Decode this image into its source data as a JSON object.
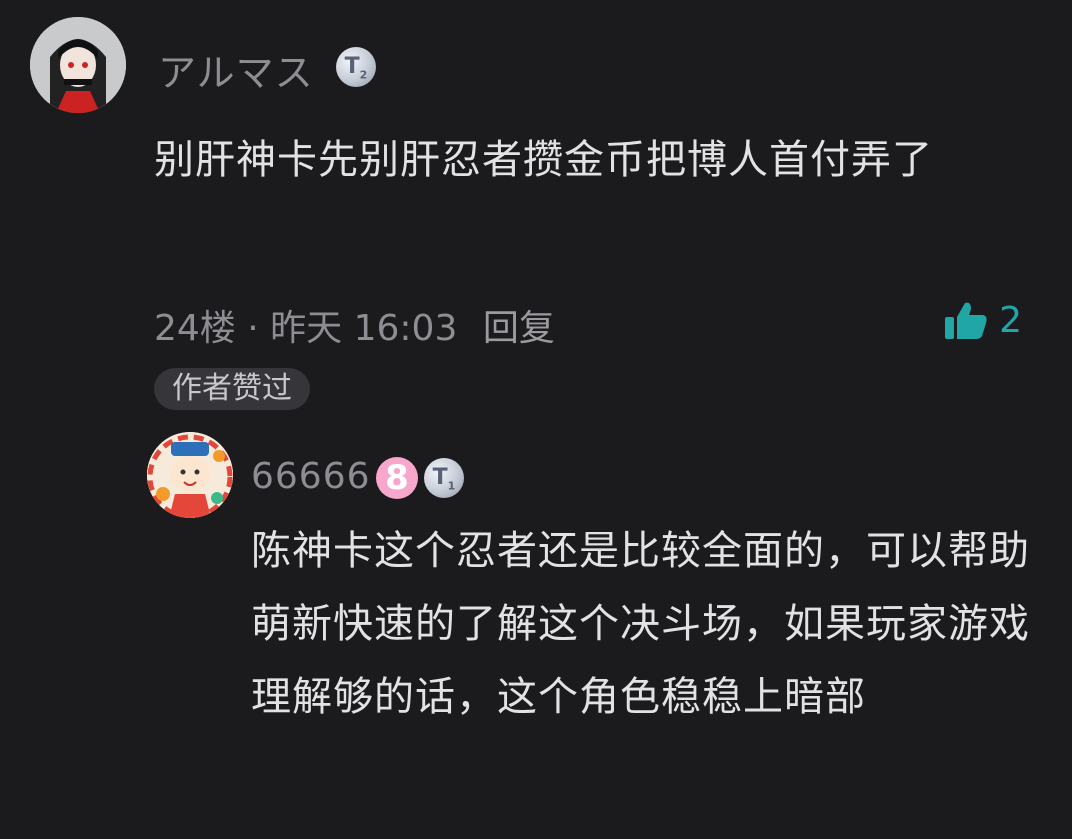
{
  "comment": {
    "author": "アルマス",
    "coin_badge": "T",
    "coin_level": "2",
    "text": "别肝神卡先别肝忍者攒金币把博人首付弄了",
    "floor": "24楼",
    "separator": "·",
    "time": "昨天 16:03",
    "reply_label": "回复",
    "like_count": "2",
    "author_liked_badge": "作者赞过"
  },
  "reply": {
    "author": "66666",
    "level": "8",
    "coin_badge": "T",
    "coin_level": "1",
    "text": "陈神卡这个忍者还是比较全面的，可以帮助萌新快速的了解这个决斗场，如果玩家游戏理解够的话，这个角色稳稳上暗部"
  },
  "icons": {
    "like": "thumbs-up-icon",
    "coin": "coin-badge-icon"
  },
  "colors": {
    "background": "#1b1b1d",
    "like_accent": "#21a6a6",
    "level_badge": "#f7a6cc"
  }
}
